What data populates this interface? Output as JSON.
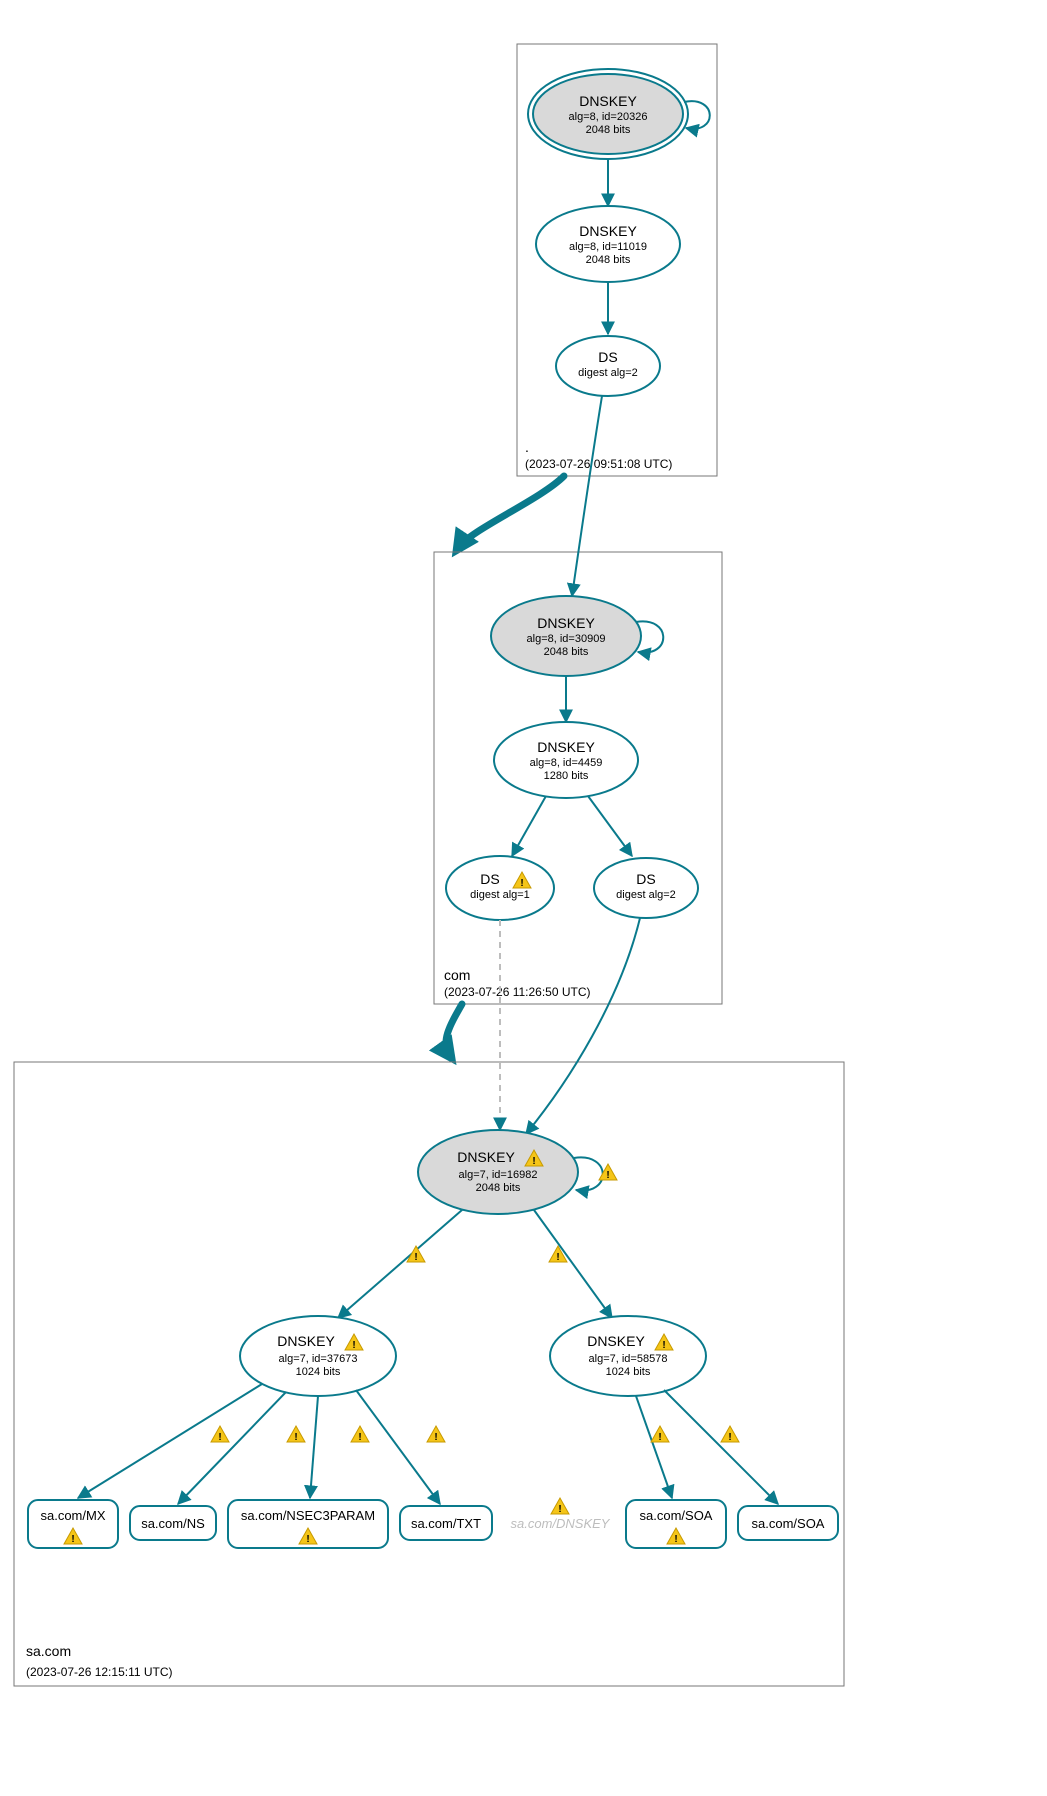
{
  "zones": {
    "root": {
      "name": ".",
      "timestamp": "(2023-07-26 09:51:08 UTC)"
    },
    "com": {
      "name": "com",
      "timestamp": "(2023-07-26 11:26:50 UTC)"
    },
    "sa": {
      "name": "sa.com",
      "timestamp": "(2023-07-26 12:15:11 UTC)"
    }
  },
  "nodes": {
    "root_ksk": {
      "title": "DNSKEY",
      "line2": "alg=8, id=20326",
      "line3": "2048 bits"
    },
    "root_zsk": {
      "title": "DNSKEY",
      "line2": "alg=8, id=11019",
      "line3": "2048 bits"
    },
    "root_ds": {
      "title": "DS",
      "line2": "digest alg=2"
    },
    "com_ksk": {
      "title": "DNSKEY",
      "line2": "alg=8, id=30909",
      "line3": "2048 bits"
    },
    "com_zsk": {
      "title": "DNSKEY",
      "line2": "alg=8, id=4459",
      "line3": "1280 bits"
    },
    "com_ds1": {
      "title": "DS",
      "line2": "digest alg=1"
    },
    "com_ds2": {
      "title": "DS",
      "line2": "digest alg=2"
    },
    "sa_ksk": {
      "title": "DNSKEY",
      "line2": "alg=7, id=16982",
      "line3": "2048 bits"
    },
    "sa_zsk1": {
      "title": "DNSKEY",
      "line2": "alg=7, id=37673",
      "line3": "1024 bits"
    },
    "sa_zsk2": {
      "title": "DNSKEY",
      "line2": "alg=7, id=58578",
      "line3": "1024 bits"
    }
  },
  "rr": {
    "mx": "sa.com/MX",
    "ns": "sa.com/NS",
    "nsec3": "sa.com/NSEC3PARAM",
    "txt": "sa.com/TXT",
    "ghost": "sa.com/DNSKEY",
    "soa1": "sa.com/SOA",
    "soa2": "sa.com/SOA"
  },
  "colors": {
    "stroke": "#0a7a8c",
    "ksk_fill": "#d9d9d9",
    "warn": "#f5c518"
  }
}
